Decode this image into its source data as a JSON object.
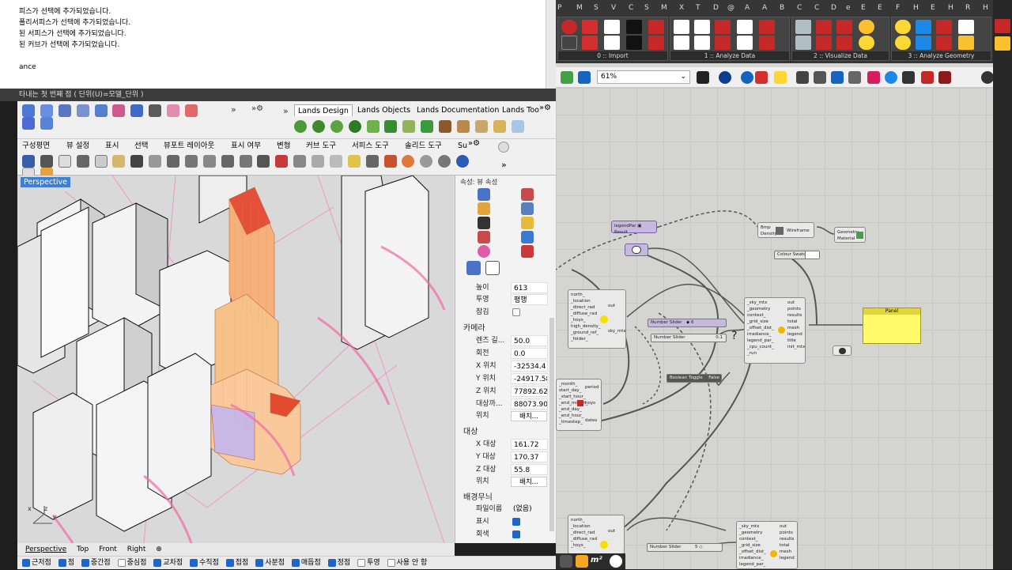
{
  "command_history": {
    "lines": [
      "피스가 선택에 추가되었습니다.",
      "폴리서피스가 선택에 추가되었습니다.",
      "된 서피스가 선택에 추가되었습니다.",
      "된 커브가 선택에 추가되었습니다.",
      "",
      "ance"
    ],
    "prompt": "타내는 첫 번째 점 ( 단위(U)=모델_단위 )"
  },
  "rhino_tabs": [
    "Lands Design",
    "Lands Objects",
    "Lands Documentation",
    "Lands Too"
  ],
  "rhino_menu": [
    "구성평면",
    "뷰 설정",
    "표시",
    "선택",
    "뷰포트 레이아웃",
    "표시 여부",
    "변형",
    "커브 도구",
    "서피스 도구",
    "솔리드 도구",
    "Su"
  ],
  "viewport": {
    "label": "Perspective"
  },
  "viewport_tabs": [
    "Perspective",
    "Top",
    "Front",
    "Right"
  ],
  "osnaps": [
    {
      "label": "근저점",
      "on": true
    },
    {
      "label": "점",
      "on": true
    },
    {
      "label": "중간점",
      "on": true
    },
    {
      "label": "중심점",
      "on": false
    },
    {
      "label": "교차점",
      "on": true
    },
    {
      "label": "수직점",
      "on": true
    },
    {
      "label": "접점",
      "on": true
    },
    {
      "label": "사분점",
      "on": true
    },
    {
      "label": "매듭점",
      "on": true
    },
    {
      "label": "정점",
      "on": true
    },
    {
      "label": "투영",
      "on": false
    },
    {
      "label": "사용 안 함",
      "on": false
    }
  ],
  "properties": {
    "title": "속성: 뷰 속성",
    "height_label": "높이",
    "height_value": "613",
    "projection_label": "투영",
    "projection_value": "평행",
    "lock_label": "잠김",
    "camera_section": "카메라",
    "lens_label": "렌즈 길...",
    "lens_value": "50.0",
    "rotation_label": "회전",
    "rotation_value": "0.0",
    "x_label": "X 위치",
    "x_value": "-32534.4",
    "y_label": "Y 위치",
    "y_value": "-24917.58",
    "z_label": "Z 위치",
    "z_value": "77892.62",
    "dist_label": "대상까...",
    "dist_value": "88073.90",
    "pos_label": "위치",
    "place_button": "배치...",
    "target_section": "대상",
    "tx_label": "X 대상",
    "tx_value": "161.72",
    "ty_label": "Y 대상",
    "ty_value": "170.37",
    "tz_label": "Z 대상",
    "tz_value": "55.8",
    "tpos_label": "위치",
    "tplace_button": "배치...",
    "wallpaper_section": "배경무늬",
    "filename_label": "파일이름",
    "filename_value": "(없음)",
    "show_label": "표시",
    "gray_label": "회색"
  },
  "gh_tabs": [
    "P",
    "M",
    "S",
    "V",
    "C",
    "S",
    "M",
    "X",
    "T",
    "D",
    "@",
    "A",
    "A",
    "B",
    "C",
    "C",
    "D",
    "e",
    "E",
    "E",
    "F",
    "H",
    "E",
    "H",
    "R",
    "H"
  ],
  "gh_groups": [
    "0 :: Import",
    "1 :: Analyze Data",
    "2 :: Visualize Data",
    "3 :: Analyze Geometry"
  ],
  "gh_zoom": "61%",
  "gh_components": {
    "legend_par": "legendPar",
    "result": "Result",
    "bmp": "Bmp",
    "density": "Density",
    "wireframe": "Wireframe",
    "geometry": "Geometry",
    "material": "Material",
    "colour_swatch": "Colour Swatch",
    "number_slider_1": "Number Slider",
    "number_slider_1_value": "◆ 6",
    "number_slider_2": "Number Slider",
    "number_slider_2_value": "0.1",
    "boolean_toggle": "Boolean Toggle",
    "boolean_value": "False",
    "panel": "Panel",
    "number_slider_3": "Number Slider",
    "number_slider_3_value": "5 ◇",
    "sky_inputs": [
      "_sky_mtx",
      "_geometry",
      "context_",
      "_grid_size",
      "_offset_dist_",
      "irradiance_",
      "legend_par_",
      "_cpu_count_",
      "_run"
    ],
    "sky_outputs": [
      "out",
      "points",
      "results",
      "total",
      "mesh",
      "legend",
      "title",
      "init_mtx"
    ],
    "epw_inputs": [
      "north_",
      "_location",
      "_direct_rad",
      "_diffuse_rad",
      "_hoys_",
      "high_density_",
      "_ground_ref_",
      "_folder_"
    ],
    "epw_outputs": [
      "out",
      "sky_mtx"
    ],
    "period_inputs": [
      "_month_",
      "start_day_",
      "_start_hour_",
      "_end_month_",
      "_end_day_",
      "_end_hour_",
      "_timestep_"
    ],
    "period_outputs": [
      "period",
      "hoys",
      "dates"
    ],
    "sky2_inputs": [
      "north_",
      "_location",
      "_direct_rad",
      "_diffuse_rad",
      "_hoys_"
    ],
    "sky2_outputs": [
      "out"
    ],
    "rad2_inputs": [
      "_sky_mtx",
      "_geometry",
      "context_",
      "_grid_size",
      "_offset_dist_",
      "irradiance_",
      "legend_par_"
    ],
    "rad2_outputs": [
      "out",
      "points",
      "results",
      "total",
      "mesh",
      "legend"
    ]
  }
}
